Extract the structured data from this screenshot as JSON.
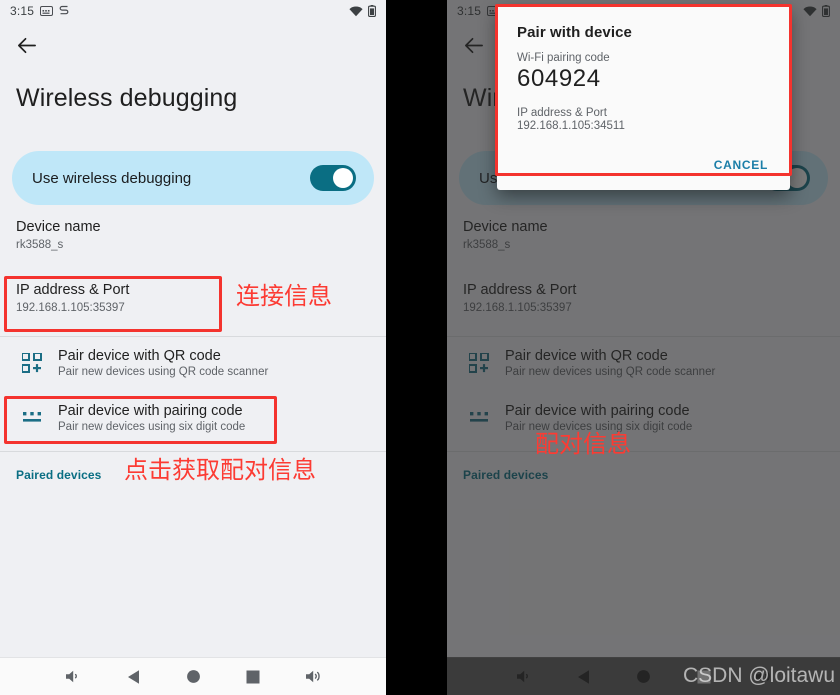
{
  "status_bar": {
    "time": "3:15",
    "icons_left": [
      "keyboard-icon",
      "usb-debugging-icon"
    ],
    "icons_right": [
      "wifi-icon",
      "battery-icon"
    ]
  },
  "appbar": {
    "back": "back-arrow-icon"
  },
  "page": {
    "title": "Wireless debugging",
    "toggle": {
      "label": "Use wireless debugging",
      "state": "on"
    },
    "device_name": {
      "title": "Device name",
      "value": "rk3588_s"
    },
    "ip_address": {
      "title": "IP address & Port",
      "value": "192.168.1.105:35397"
    },
    "qr_row": {
      "title": "Pair device with QR code",
      "subtitle": "Pair new devices using QR code scanner",
      "icon": "qr-code-icon"
    },
    "code_row": {
      "title": "Pair device with pairing code",
      "subtitle": "Pair new devices using six digit code",
      "icon": "pairing-code-icon"
    },
    "paired_devices": "Paired devices"
  },
  "dialog": {
    "title": "Pair with device",
    "code_label": "Wi-Fi pairing code",
    "code_value": "604924",
    "ip_label": "IP address & Port",
    "ip_value": "192.168.1.105:34511",
    "cancel": "CANCEL"
  },
  "annotations": {
    "left_connection": "连接信息",
    "left_click": "点击获取配对信息",
    "right_pairing": "配对信息",
    "color": "#fc3b33"
  },
  "navbar": {
    "buttons": [
      "volume-down-icon",
      "back-icon",
      "home-icon",
      "recents-icon",
      "volume-up-icon"
    ]
  },
  "watermark": "CSDN @loitawu",
  "colors": {
    "accent_teal": "#0a6e83",
    "toggle_card_bg": "#bfe7f8",
    "page_bg": "#eff0f3",
    "annotation_red": "#fc3b33"
  }
}
